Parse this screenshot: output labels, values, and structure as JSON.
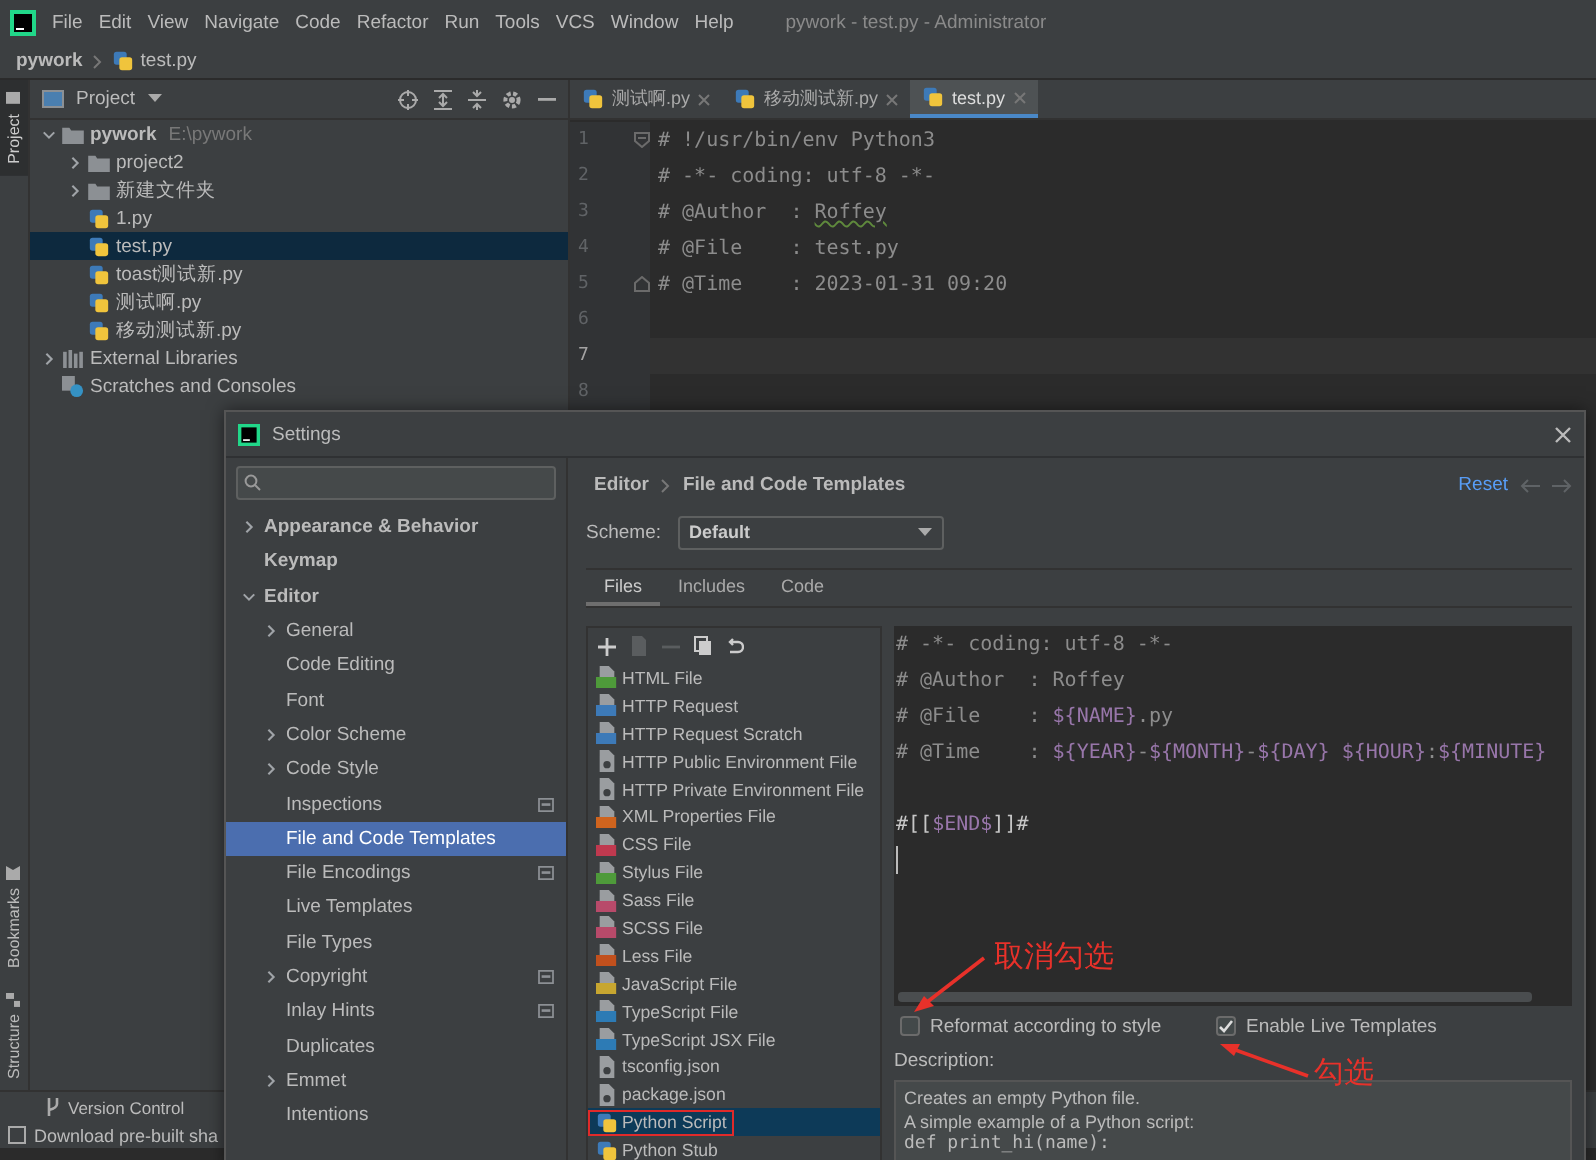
{
  "menu_bar": {
    "items": [
      "File",
      "Edit",
      "View",
      "Navigate",
      "Code",
      "Refactor",
      "Run",
      "Tools",
      "VCS",
      "Window",
      "Help"
    ],
    "title": "pywork - test.py - Administrator"
  },
  "nav_bar": {
    "crumbs": [
      "pywork",
      "test.py"
    ]
  },
  "tool_strip": {
    "top": [
      {
        "label": "Project",
        "kind": "project",
        "selected": true
      }
    ],
    "bottom": [
      {
        "label": "Bookmarks",
        "kind": "bookmarks",
        "selected": false
      },
      {
        "label": "Structure",
        "kind": "structure",
        "selected": false
      }
    ]
  },
  "project_panel": {
    "title": "Project",
    "tree": [
      {
        "name": "pywork",
        "path": "E:\\pywork",
        "kind": "folder",
        "expanded": true,
        "selected": false,
        "children": [
          {
            "name": "project2",
            "kind": "folder",
            "expanded": false,
            "selected": false
          },
          {
            "name": "新建文件夹",
            "kind": "folder",
            "expanded": false,
            "selected": false
          },
          {
            "name": "1.py",
            "kind": "python",
            "selected": false
          },
          {
            "name": "test.py",
            "kind": "python",
            "selected": true
          },
          {
            "name": "toast测试新.py",
            "kind": "python",
            "selected": false
          },
          {
            "name": "测试啊.py",
            "kind": "python",
            "selected": false
          },
          {
            "name": "移动测试新.py",
            "kind": "python",
            "selected": false
          }
        ]
      },
      {
        "name": "External Libraries",
        "kind": "libraries",
        "expanded": false,
        "selected": false
      },
      {
        "name": "Scratches and Consoles",
        "kind": "scratches",
        "selected": false
      }
    ]
  },
  "editor": {
    "tabs": [
      {
        "label": "测试啊.py",
        "selected": false
      },
      {
        "label": "移动测试新.py",
        "selected": false
      },
      {
        "label": "test.py",
        "selected": true
      }
    ],
    "lines": [
      {
        "number": "1",
        "current": false,
        "kind": "fold_start",
        "parts": [
          {
            "text": "# !/usr/bin/env Python3",
            "kind": "comment"
          }
        ]
      },
      {
        "number": "2",
        "current": false,
        "kind": "plain",
        "parts": [
          {
            "text": "# -*- coding: utf-8 -*-",
            "kind": "comment"
          }
        ]
      },
      {
        "number": "3",
        "current": false,
        "kind": "plain",
        "parts": [
          {
            "text": "# @Author  : ",
            "kind": "comment"
          },
          {
            "text": "Roffey",
            "kind": "typo"
          }
        ]
      },
      {
        "number": "4",
        "current": false,
        "kind": "plain",
        "parts": [
          {
            "text": "# @File    : test.py",
            "kind": "comment"
          }
        ]
      },
      {
        "number": "5",
        "current": false,
        "kind": "fold_end",
        "parts": [
          {
            "text": "# @Time    : 2023-01-31 09:20",
            "kind": "comment"
          }
        ]
      },
      {
        "number": "6",
        "current": false,
        "kind": "plain"
      },
      {
        "number": "7",
        "current": true,
        "kind": "plain"
      },
      {
        "number": "8",
        "current": false,
        "kind": "plain"
      }
    ]
  },
  "settings": {
    "title": "Settings",
    "nav": [
      {
        "label": "Appearance & Behavior",
        "kind": "group",
        "expanded": false,
        "selected": false,
        "project_scoped": false
      },
      {
        "label": "Keymap",
        "kind": "page",
        "selected": false,
        "project_scoped": false
      },
      {
        "label": "Editor",
        "kind": "group",
        "expanded": true,
        "selected": false,
        "project_scoped": false,
        "children": [
          {
            "label": "General",
            "kind": "group",
            "expanded": false,
            "selected": false,
            "project_scoped": false
          },
          {
            "label": "Code Editing",
            "kind": "page",
            "selected": false,
            "project_scoped": false
          },
          {
            "label": "Font",
            "kind": "page",
            "selected": false,
            "project_scoped": false
          },
          {
            "label": "Color Scheme",
            "kind": "group",
            "expanded": false,
            "selected": false,
            "project_scoped": false
          },
          {
            "label": "Code Style",
            "kind": "group",
            "expanded": false,
            "selected": false,
            "project_scoped": false
          },
          {
            "label": "Inspections",
            "kind": "page",
            "selected": false,
            "project_scoped": true
          },
          {
            "label": "File and Code Templates",
            "kind": "page",
            "selected": true,
            "project_scoped": false
          },
          {
            "label": "File Encodings",
            "kind": "page",
            "selected": false,
            "project_scoped": true
          },
          {
            "label": "Live Templates",
            "kind": "page",
            "selected": false,
            "project_scoped": false
          },
          {
            "label": "File Types",
            "kind": "page",
            "selected": false,
            "project_scoped": false
          },
          {
            "label": "Copyright",
            "kind": "group",
            "expanded": false,
            "selected": false,
            "project_scoped": true
          },
          {
            "label": "Inlay Hints",
            "kind": "page",
            "selected": false,
            "project_scoped": true
          },
          {
            "label": "Duplicates",
            "kind": "page",
            "selected": false,
            "project_scoped": false
          },
          {
            "label": "Emmet",
            "kind": "group",
            "expanded": false,
            "selected": false,
            "project_scoped": false
          },
          {
            "label": "Intentions",
            "kind": "page",
            "selected": false,
            "project_scoped": false
          }
        ]
      }
    ],
    "breadcrumb": [
      "Editor",
      "File and Code Templates"
    ],
    "reset": "Reset",
    "scheme": {
      "label": "Scheme:",
      "value": "Default"
    },
    "tabs": [
      {
        "label": "Files",
        "selected": true
      },
      {
        "label": "Includes",
        "selected": false
      },
      {
        "label": "Code",
        "selected": false
      }
    ],
    "templates": [
      {
        "name": "HTML File",
        "kind": "badge",
        "color": "#4e9a3a",
        "selected": false,
        "highlighted": false
      },
      {
        "name": "HTTP Request",
        "kind": "badge",
        "color": "#3d7ab8",
        "selected": false,
        "highlighted": false
      },
      {
        "name": "HTTP Request Scratch",
        "kind": "badge",
        "color": "#3d7ab8",
        "selected": false,
        "highlighted": false
      },
      {
        "name": "HTTP Public Environment File",
        "kind": "plain",
        "selected": false,
        "highlighted": false
      },
      {
        "name": "HTTP Private Environment File",
        "kind": "plain",
        "selected": false,
        "highlighted": false
      },
      {
        "name": "XML Properties File",
        "kind": "badge",
        "color": "#d0641e",
        "selected": false,
        "highlighted": false
      },
      {
        "name": "CSS File",
        "kind": "badge",
        "color": "#c0394f",
        "selected": false,
        "highlighted": false
      },
      {
        "name": "Stylus File",
        "kind": "badge",
        "color": "#4e9a3a",
        "selected": false,
        "highlighted": false
      },
      {
        "name": "Sass File",
        "kind": "badge",
        "color": "#b84a6a",
        "selected": false,
        "highlighted": false
      },
      {
        "name": "SCSS File",
        "kind": "badge",
        "color": "#b84a6a",
        "selected": false,
        "highlighted": false
      },
      {
        "name": "Less File",
        "kind": "badge",
        "color": "#c2501d",
        "selected": false,
        "highlighted": false
      },
      {
        "name": "JavaScript File",
        "kind": "badge",
        "color": "#c7a630",
        "selected": false,
        "highlighted": false
      },
      {
        "name": "TypeScript File",
        "kind": "badge",
        "color": "#2d7bb5",
        "selected": false,
        "highlighted": false
      },
      {
        "name": "TypeScript JSX File",
        "kind": "badge",
        "color": "#2d7bb5",
        "selected": false,
        "highlighted": false
      },
      {
        "name": "tsconfig.json",
        "kind": "plain",
        "selected": false,
        "highlighted": false
      },
      {
        "name": "package.json",
        "kind": "plain",
        "selected": false,
        "highlighted": false
      },
      {
        "name": "Python Script",
        "kind": "python",
        "selected": true,
        "highlighted": true
      },
      {
        "name": "Python Stub",
        "kind": "python",
        "selected": false,
        "highlighted": false
      }
    ],
    "template_lines": [
      {
        "cursor": false,
        "parts": [
          {
            "text": "# -*- coding: utf-8 -*-",
            "kind": "comment"
          }
        ]
      },
      {
        "cursor": false,
        "parts": [
          {
            "text": "# @Author  : Roffey",
            "kind": "comment"
          }
        ]
      },
      {
        "cursor": false,
        "parts": [
          {
            "text": "# @File    : ",
            "kind": "comment"
          },
          {
            "text": "${NAME}",
            "kind": "var"
          },
          {
            "text": ".py",
            "kind": "comment"
          }
        ]
      },
      {
        "cursor": false,
        "parts": [
          {
            "text": "# @Time    : ",
            "kind": "comment"
          },
          {
            "text": "${YEAR}",
            "kind": "var"
          },
          {
            "text": "-",
            "kind": "comment"
          },
          {
            "text": "${MONTH}",
            "kind": "var"
          },
          {
            "text": "-",
            "kind": "comment"
          },
          {
            "text": "${DAY}",
            "kind": "var"
          },
          {
            "text": " ${HOUR}",
            "kind": "var"
          },
          {
            "text": ":",
            "kind": "comment"
          },
          {
            "text": "${MINUTE}",
            "kind": "var"
          }
        ]
      },
      {
        "cursor": false
      },
      {
        "cursor": false,
        "parts": [
          {
            "text": "#[[",
            "kind": "plain"
          },
          {
            "text": "$END$",
            "kind": "var"
          },
          {
            "text": "]]#",
            "kind": "plain"
          }
        ]
      },
      {
        "cursor": true
      }
    ],
    "options": [
      {
        "label": "Reformat according to style",
        "checked": false
      },
      {
        "label": "Enable Live Templates",
        "checked": true
      }
    ],
    "description": {
      "label": "Description:",
      "lines": [
        "Creates an empty Python file.",
        "A simple example of a Python script:",
        "def print_hi(name):"
      ]
    }
  },
  "status": {
    "tool_window": "Version Control",
    "message": "Download pre-built sha"
  },
  "annotations": [
    {
      "text": "取消勾选"
    },
    {
      "text": "勾选"
    }
  ]
}
